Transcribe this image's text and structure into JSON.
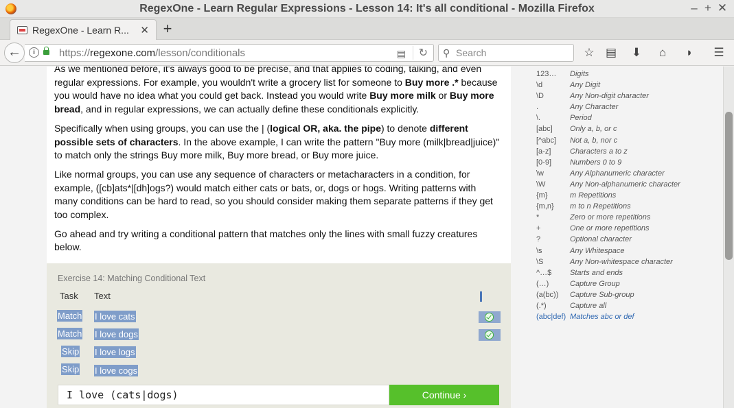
{
  "window": {
    "title": "RegexOne - Learn Regular Expressions - Lesson 14: It's all conditional - Mozilla Firefox",
    "controls": {
      "minimize": "–",
      "maximize": "+",
      "close": "✕"
    }
  },
  "tab": {
    "label": "RegexOne - Learn R...",
    "close": "✕",
    "new_tab": "+"
  },
  "nav": {
    "back": "←",
    "url_scheme": "https://",
    "url_domain": "regexone.com",
    "url_path": "/lesson/conditionals",
    "reader": "▤",
    "reload": "↻",
    "search_icon": "⚲",
    "search_placeholder": "Search",
    "icons": [
      "star-icon",
      "library-icon",
      "download-icon",
      "home-icon",
      "pocket-icon",
      "menu-icon"
    ],
    "icon_glyphs": {
      "star": "☆",
      "library": "▤",
      "download": "⬇",
      "home": "⌂",
      "pocket": "◗",
      "menu": "☰"
    }
  },
  "lesson": {
    "p1": {
      "a": "As we mentioned before, it's always good to be precise, and that applies to coding, talking, and even regular expressions. For example, you wouldn't write a grocery list for someone to ",
      "b1": "Buy more .*",
      "c": " because you would have no idea what you could get back. Instead you would write ",
      "b2": "Buy more milk",
      "d": " or ",
      "b3": "Buy more bread",
      "e": ", and in regular expressions, we can actually define these conditionals explicitly."
    },
    "p2": {
      "a": "Specifically when using groups, you can use the | (",
      "b1": "logical OR, aka. the pipe",
      "c": ") to denote ",
      "b2": "different possible sets of characters",
      "d": ". In the above example, I can write the pattern \"Buy more (milk|bread|juice)\" to match only the strings Buy more milk, Buy more bread, or Buy more juice."
    },
    "p3": "Like normal groups, you can use any sequence of characters or metacharacters in a condition, for example, ([cb]ats*|[dh]ogs?) would match either cats or bats, or, dogs or hogs. Writing patterns with many conditions can be hard to read, so you should consider making them separate patterns if they get too complex.",
    "p4": "Go ahead and try writing a conditional pattern that matches only the lines with small fuzzy creatures below."
  },
  "exercise": {
    "title": "Exercise 14: Matching Conditional Text",
    "col_task": "Task",
    "col_text": "Text",
    "rows": [
      {
        "task": "Match",
        "text": "I love cats",
        "passed": true
      },
      {
        "task": "Match",
        "text": "I love dogs",
        "passed": true
      },
      {
        "task": "Skip",
        "text": "I love logs",
        "passed": false
      },
      {
        "task": "Skip",
        "text": "I love cogs",
        "passed": false
      }
    ],
    "input_value": "I love (cats|dogs)",
    "continue_label": "Continue ›"
  },
  "reference": [
    {
      "sym": "123…",
      "desc": "Digits"
    },
    {
      "sym": "\\d",
      "desc": "Any Digit"
    },
    {
      "sym": "\\D",
      "desc": "Any Non-digit character"
    },
    {
      "sym": ".",
      "desc": "Any Character"
    },
    {
      "sym": "\\.",
      "desc": "Period"
    },
    {
      "sym": "[abc]",
      "desc": "Only a, b, or c"
    },
    {
      "sym": "[^abc]",
      "desc": "Not a, b, nor c"
    },
    {
      "sym": "[a-z]",
      "desc": "Characters a to z"
    },
    {
      "sym": "[0-9]",
      "desc": "Numbers 0 to 9"
    },
    {
      "sym": "\\w",
      "desc": "Any Alphanumeric character"
    },
    {
      "sym": "\\W",
      "desc": "Any Non-alphanumeric character"
    },
    {
      "sym": "{m}",
      "desc": "m Repetitions"
    },
    {
      "sym": "{m,n}",
      "desc": "m to n Repetitions"
    },
    {
      "sym": "*",
      "desc": "Zero or more repetitions"
    },
    {
      "sym": "+",
      "desc": "One or more repetitions"
    },
    {
      "sym": "?",
      "desc": "Optional character"
    },
    {
      "sym": "\\s",
      "desc": "Any Whitespace"
    },
    {
      "sym": "\\S",
      "desc": "Any Non-whitespace character"
    },
    {
      "sym": "^…$",
      "desc": "Starts and ends"
    },
    {
      "sym": "(…)",
      "desc": "Capture Group"
    },
    {
      "sym": "(a(bc))",
      "desc": "Capture Sub-group"
    },
    {
      "sym": "(.*)",
      "desc": "Capture all"
    },
    {
      "sym": "(abc|def)",
      "desc": "Matches abc or def",
      "highlight": true
    }
  ],
  "colors": {
    "continue": "#56c02b",
    "selection": "#7f9dc9",
    "check": "#3cb13c",
    "link": "#2e67b1"
  }
}
